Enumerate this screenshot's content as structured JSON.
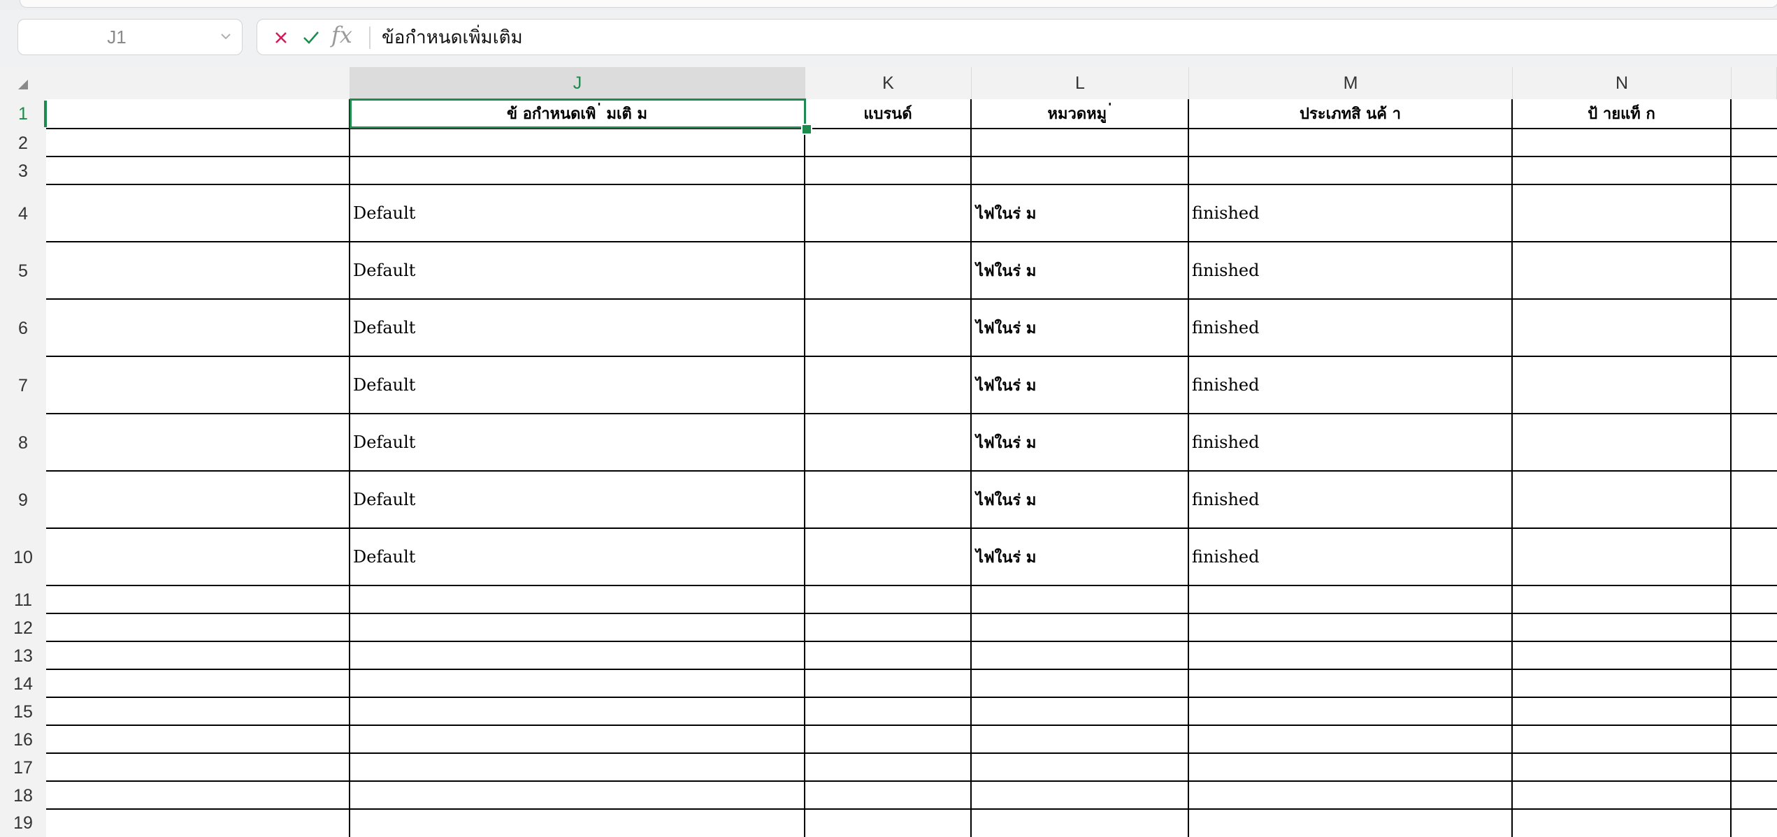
{
  "name_box": {
    "value": "J1"
  },
  "formula_bar": {
    "content": "ข้อกำหนดเพิ่มเติม"
  },
  "icons": {
    "cancel": "x-icon",
    "confirm": "check-icon",
    "function": "fx-icon",
    "namebox_dropdown": "chevron-down-icon",
    "select_all": "select-all-triangle-icon"
  },
  "colors": {
    "accent": "#1e8b4e",
    "cancel": "#d6195a",
    "header_bg": "#f2f2f2",
    "selected_header_bg": "#dcdcdc"
  },
  "columns": [
    {
      "letter": "J",
      "selected": true
    },
    {
      "letter": "K",
      "selected": false
    },
    {
      "letter": "L",
      "selected": false
    },
    {
      "letter": "M",
      "selected": false
    },
    {
      "letter": "N",
      "selected": false
    }
  ],
  "rows": [
    "1",
    "2",
    "3",
    "4",
    "5",
    "6",
    "7",
    "8",
    "9",
    "10",
    "11",
    "12",
    "13",
    "14",
    "15",
    "16",
    "17",
    "18",
    "19"
  ],
  "selected_cell": "J1",
  "sheet": {
    "headers": [
      "ข้ อกำหนดเพิ ่ มเติ ม",
      "แบรนด์",
      "หมวดหมู ่",
      "ประเภทสิ นค้ า",
      "ป้ ายแท็ ก"
    ],
    "data_rows": [
      {
        "row": "4",
        "j": "Default",
        "l": "ไฟในร่ ม",
        "m": "finished"
      },
      {
        "row": "5",
        "j": "Default",
        "l": "ไฟในร่ ม",
        "m": "finished"
      },
      {
        "row": "6",
        "j": "Default",
        "l": "ไฟในร่ ม",
        "m": "finished"
      },
      {
        "row": "7",
        "j": "Default",
        "l": "ไฟในร่ ม",
        "m": "finished"
      },
      {
        "row": "8",
        "j": "Default",
        "l": "ไฟในร่ ม",
        "m": "finished"
      },
      {
        "row": "9",
        "j": "Default",
        "l": "ไฟในร่ ม",
        "m": "finished"
      },
      {
        "row": "10",
        "j": "Default",
        "l": "ไฟในร่ ม",
        "m": "finished"
      }
    ]
  }
}
